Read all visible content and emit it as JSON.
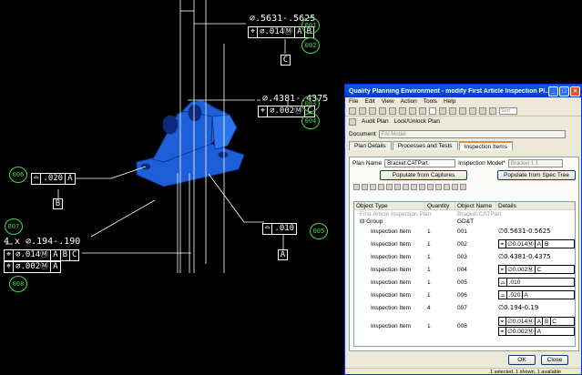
{
  "cad": {
    "annotations": {
      "a1_dim": "∅.5631-.5625",
      "a1_fcf": [
        "⌖",
        "∅.014Ⓜ",
        "A",
        "B"
      ],
      "a1_datum": "C",
      "a2_dim": "∅.4381-.4375",
      "a2_fcf": [
        "⌖",
        "∅.002Ⓜ",
        "C"
      ],
      "a3_fcf": [
        "⌓",
        ".020",
        "A"
      ],
      "a3_datum": "B",
      "a4_fcf": [
        "⌓",
        ".010"
      ],
      "a4_datum": "A",
      "a5_dim": "4 x ∅.194-.190",
      "a5_fcf1": [
        "⌖",
        "∅.014Ⓜ",
        "A",
        "B",
        "C"
      ],
      "a5_fcf2": [
        "⌖",
        "∅.002Ⓜ",
        "A"
      ]
    },
    "balloons": [
      "001",
      "002",
      "003",
      "004",
      "005",
      "006",
      "007",
      "008"
    ],
    "colors": {
      "part": "#1d5fd8",
      "balloon": "#3ddc3d",
      "lines": "#ffffff",
      "background": "#000000"
    }
  },
  "window": {
    "title": "Quality Planning Environment - modify First Article Inspection Pl...",
    "menu": [
      "File",
      "Edit",
      "View",
      "Action",
      "Tools",
      "Help"
    ],
    "sort_label": "Sort",
    "actions": [
      "Audit Plan",
      "Lock/Unlock Plan"
    ],
    "document_label": "Document",
    "document_value": "FAI Model",
    "tabs": [
      "Plan Details",
      "Processes and Tests",
      "Inspection Items"
    ],
    "plan_name_label": "Plan Name",
    "plan_name_value": "Bracket.CATPart",
    "inspection_model_label": "Inspection Model*",
    "inspection_model_value": "Bracket 1.1",
    "populate_captures": "Populate from Captures",
    "populate_spec": "Populate from Spec Tree",
    "columns": [
      "Object Type",
      "Quantity",
      "Object Name",
      "Details"
    ],
    "tree_root": "First Article Inspection Plan",
    "tree_root_name": "Bracket.CATPart",
    "group_label": "Group",
    "group_name": "GD&T",
    "rows": [
      {
        "type": "Inspection Item",
        "qty": "1",
        "name": "001",
        "detail": "∅0.5631-0.5625"
      },
      {
        "type": "Inspection Item",
        "qty": "1",
        "name": "002",
        "fcf": [
          "⌖",
          "∅0.014Ⓜ",
          "A",
          "B"
        ]
      },
      {
        "type": "Inspection Item",
        "qty": "1",
        "name": "003",
        "detail": "∅0.4381-0.4375"
      },
      {
        "type": "Inspection Item",
        "qty": "1",
        "name": "004",
        "fcf": [
          "⌖",
          "∅0.002Ⓜ",
          "C"
        ]
      },
      {
        "type": "Inspection Item",
        "qty": "1",
        "name": "005",
        "fcf": [
          "⌓",
          ".010"
        ]
      },
      {
        "type": "Inspection Item",
        "qty": "1",
        "name": "006",
        "fcf": [
          "⌓",
          ".020",
          "A"
        ]
      },
      {
        "type": "Inspection Item",
        "qty": "4",
        "name": "007",
        "detail": "∅0.194-0.19"
      },
      {
        "type": "Inspection Item",
        "qty": "1",
        "name": "008",
        "fcf": [
          "⌖",
          "∅0.014Ⓜ",
          "A",
          "B",
          "C"
        ],
        "fcf2": [
          "⌖",
          "∅0.002Ⓜ",
          "A"
        ]
      }
    ],
    "ok": "OK",
    "close": "Close",
    "status": "1 selected, 1 shown, 1 available"
  }
}
